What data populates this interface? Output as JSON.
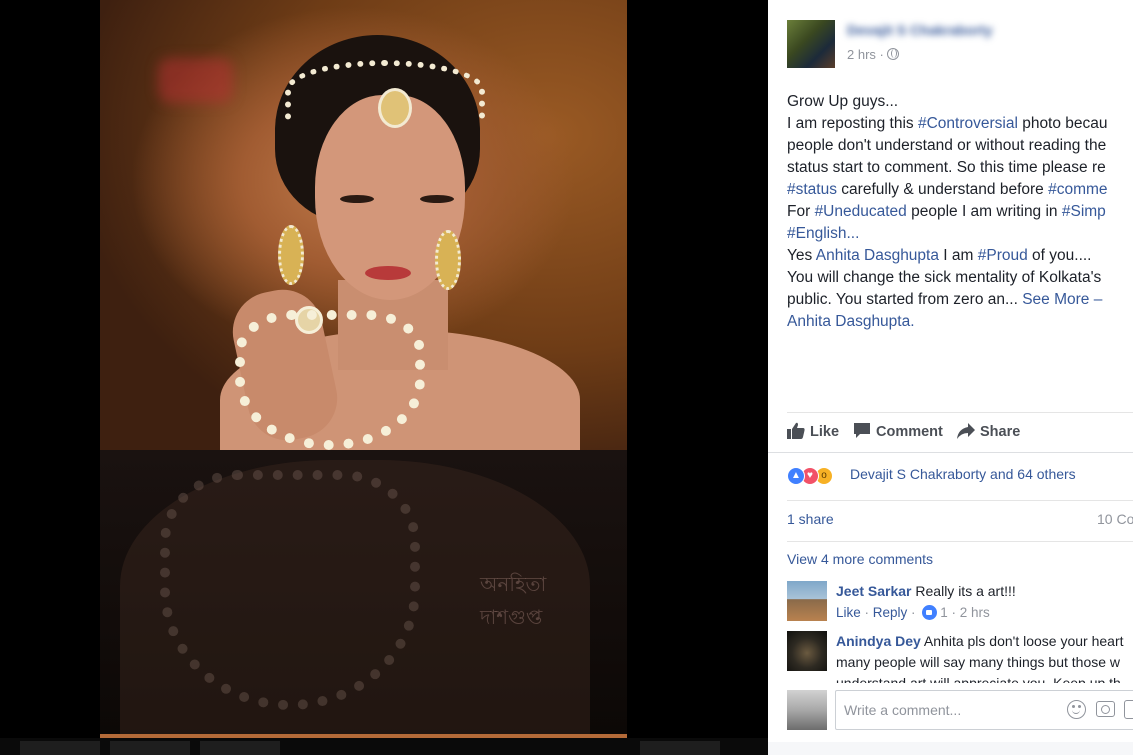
{
  "photo": {
    "watermark_text": "অনহিতা দাশগুপ্ত"
  },
  "post": {
    "author_name": "Devajit S Chakraborty",
    "time": "2 hrs ·",
    "text_lines": {
      "l1": "Grow Up guys...",
      "l2": "I am reposting this ",
      "l2_tag": "#Controversial",
      "l2_end": " photo becau",
      "l3": "people don't understand or without reading the",
      "l4": "status start to comment. So this time please re",
      "l5_tag1": "#status",
      "l5_mid": " carefully & understand before ",
      "l5_tag2": "#comme",
      "l6": "For ",
      "l6_tag1": "#Uneducated",
      "l6_mid": " people I am writing in ",
      "l6_tag2": "#Simp",
      "l7_tag": "#English...",
      "l8": "Yes ",
      "l8_name": "Anhita Dasghupta",
      "l8_mid": " I am ",
      "l8_tag": "#Proud",
      "l8_end": " of you....",
      "l9": "You will change the sick mentality of Kolkata's",
      "l10": "public. You started from zero an... ",
      "l10_more": "See More",
      "l10_dash": " –",
      "l11_name": "Anhita Dasghupta."
    }
  },
  "actions": {
    "like_label": "Like",
    "comment_label": "Comment",
    "share_label": "Share"
  },
  "reactions": {
    "summary": "Devajit S Chakraborty and 64 others",
    "shares": "1 share",
    "comments_count": "10 Co"
  },
  "comments": {
    "view_more": "View 4 more comments",
    "items": [
      {
        "name": "Jeet Sarkar",
        "text": " Really its a art!!!",
        "like_link": "Like",
        "sep1": " · ",
        "reply_link": "Reply",
        "sep2": " · ",
        "likes": "1",
        "time": " · 2 hrs"
      },
      {
        "name": "Anindya Dey",
        "text": " Anhita pls don't loose your heart",
        "line2": "many people will say many things but those w",
        "line3": "understand art will appreciate you. Keep up th"
      }
    ],
    "input_placeholder": "Write a comment..."
  },
  "colors": {
    "link": "#365899",
    "like_blue": "#4080ff",
    "love_red": "#f25268",
    "wow_yellow": "#f7b125"
  },
  "icons": [
    "like-thumb-icon",
    "comment-bubble-icon",
    "share-arrow-icon",
    "globe-icon",
    "emoji-icon",
    "camera-icon",
    "gif-icon"
  ]
}
